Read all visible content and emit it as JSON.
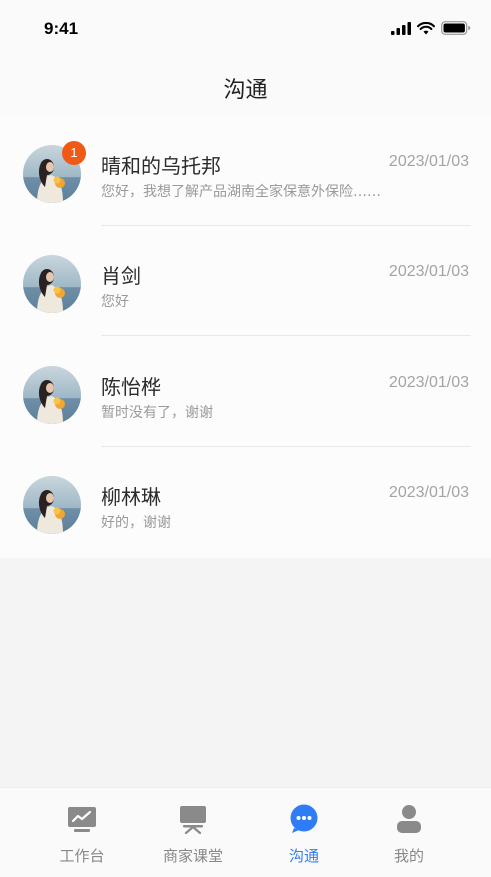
{
  "status_bar": {
    "time": "9:41"
  },
  "header": {
    "title": "沟通"
  },
  "conversations": [
    {
      "name": "晴和的乌托邦",
      "date": "2023/01/03",
      "preview": "您好，我想了解产品湖南全家保意外保险……",
      "unread": "1"
    },
    {
      "name": "肖剑",
      "date": "2023/01/03",
      "preview": "您好",
      "unread": ""
    },
    {
      "name": "陈怡桦",
      "date": "2023/01/03",
      "preview": "暂时没有了，谢谢",
      "unread": ""
    },
    {
      "name": "柳林琳",
      "date": "2023/01/03",
      "preview": "好的，谢谢",
      "unread": ""
    }
  ],
  "tabs": [
    {
      "label": "工作台",
      "icon": "dashboard-chart-icon",
      "active": false
    },
    {
      "label": "商家课堂",
      "icon": "classroom-board-icon",
      "active": false
    },
    {
      "label": "沟通",
      "icon": "chat-bubble-icon",
      "active": true
    },
    {
      "label": "我的",
      "icon": "user-profile-icon",
      "active": false
    }
  ],
  "colors": {
    "accent": "#2f7df6",
    "badge": "#ef5a16",
    "inactive_tab": "#888888"
  }
}
